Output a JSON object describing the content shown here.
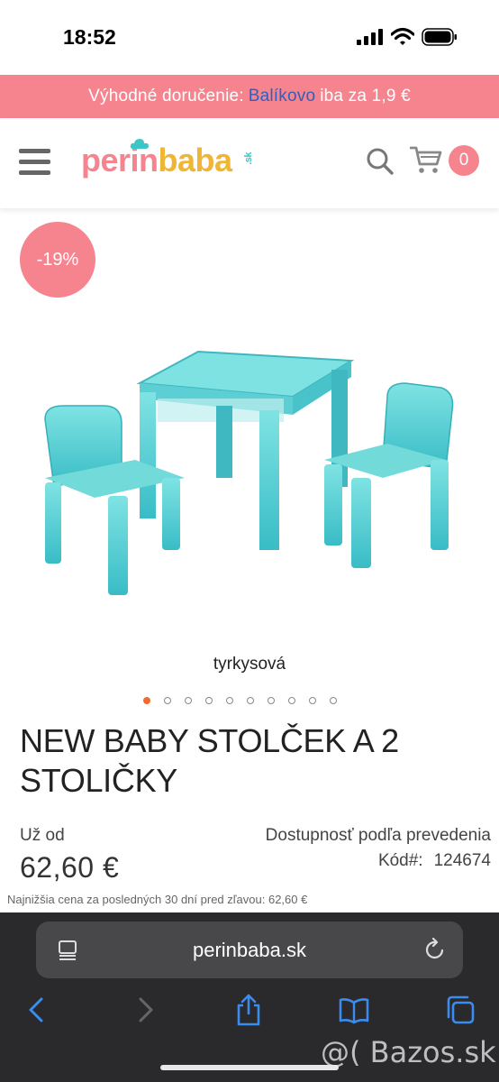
{
  "status_bar": {
    "time": "18:52"
  },
  "promo": {
    "prefix": "Výhodné doručenie:",
    "highlight": "Balíkovo",
    "suffix": "iba za 1,9 €"
  },
  "header": {
    "logo_part1": "perin",
    "logo_part2": "baba",
    "logo_tld": ".sk",
    "cart_count": "0"
  },
  "product": {
    "discount_badge": "-19%",
    "variant": "tyrkysová",
    "gallery_dots": 10,
    "active_dot": 0,
    "title": "NEW BABY STOLČEK A 2 STOLIČKY",
    "price_prefix": "Už od",
    "price": "62,60 €",
    "availability": "Dostupnosť podľa prevedenia",
    "code_label": "Kód#:",
    "code_value": "124674",
    "lowest_price_note": "Najnižšia cena za posledných 30 dní pred zľavou: 62,60 €"
  },
  "browser": {
    "url": "perinbaba.sk"
  },
  "watermark": "@( Bazos.sk",
  "colors": {
    "brand_pink": "#f6848e",
    "brand_yellow": "#f0b535",
    "brand_teal": "#3cc6c6",
    "link_blue": "#2f5fbf",
    "active_dot": "#f26a2e",
    "safari_bg": "#2a2a2c"
  },
  "icons": [
    "signal-icon",
    "wifi-icon",
    "battery-icon",
    "hamburger-icon",
    "search-icon",
    "cart-icon",
    "reader-icon",
    "reload-icon",
    "back-icon",
    "forward-icon",
    "share-icon",
    "bookmarks-icon",
    "tabs-icon"
  ]
}
